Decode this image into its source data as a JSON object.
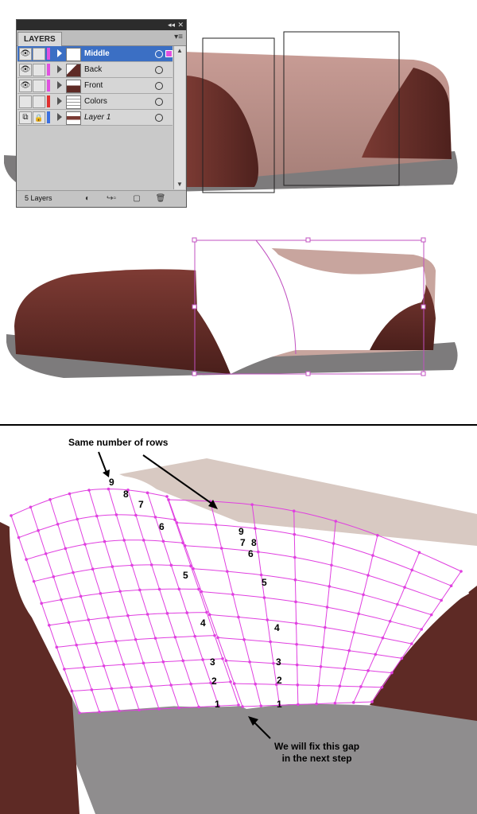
{
  "panel": {
    "tab_label": "LAYERS",
    "footer_count": "5 Layers",
    "collapse_icon": "double-chevron-left-icon",
    "close_icon": "close-icon",
    "menu_icon": "panel-menu-icon",
    "layers": [
      {
        "name": "Middle",
        "selected": true,
        "visible": true,
        "locked": false,
        "color": "#e050e0"
      },
      {
        "name": "Back",
        "selected": false,
        "visible": true,
        "locked": false,
        "color": "#e050e0"
      },
      {
        "name": "Front",
        "selected": false,
        "visible": true,
        "locked": false,
        "color": "#e050e0"
      },
      {
        "name": "Colors",
        "selected": false,
        "visible": false,
        "locked": false,
        "color": "#e03030"
      },
      {
        "name": "Layer 1",
        "selected": false,
        "visible": false,
        "locked": true,
        "color": "#3a6fe0"
      }
    ],
    "footer_buttons": [
      "make-clipping-mask-icon",
      "create-sublayer-icon",
      "new-layer-icon",
      "trash-icon"
    ]
  },
  "annotations": {
    "same_rows": "Same number of rows",
    "fix_gap_line1": "We will fix this gap",
    "fix_gap_line2": "in the next step"
  },
  "row_numbers_left": [
    "9",
    "8",
    "7",
    "6",
    "5",
    "4",
    "3",
    "2",
    "1"
  ],
  "row_numbers_right": [
    "9",
    "8",
    "7",
    "6",
    "5",
    "4",
    "3",
    "2",
    "1"
  ],
  "colors": {
    "shoe_dark": "#5e2a25",
    "shoe_light": "#b88f86",
    "sole": "#7d7b7c",
    "mesh": "#e040e0",
    "selection": "#c050c0"
  }
}
